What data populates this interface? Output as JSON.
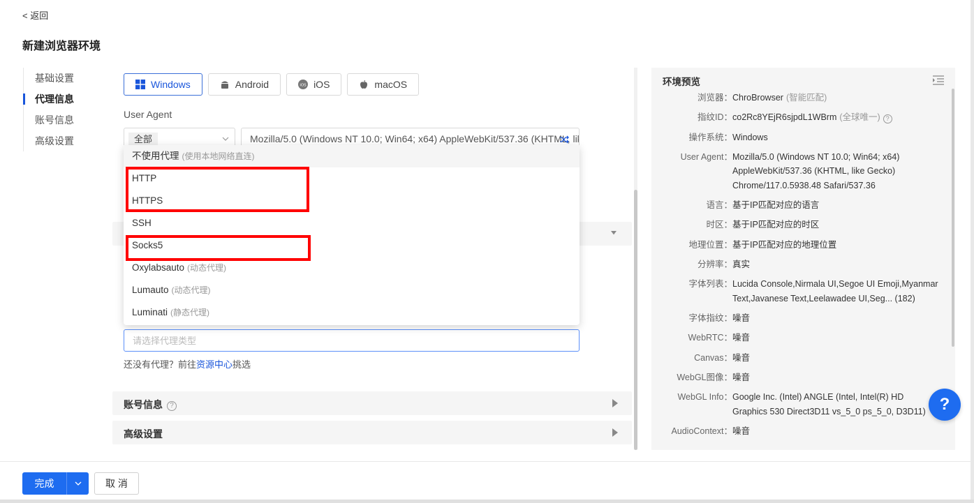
{
  "header": {
    "back": "< 返回",
    "title": "新建浏览器环境"
  },
  "nav": [
    {
      "label": "基础设置",
      "active": false
    },
    {
      "label": "代理信息",
      "active": true
    },
    {
      "label": "账号信息",
      "active": false
    },
    {
      "label": "高级设置",
      "active": false
    }
  ],
  "os_buttons": {
    "windows": "Windows",
    "android": "Android",
    "ios": "iOS",
    "macos": "macOS"
  },
  "user_agent": {
    "label": "User Agent",
    "filter": "全部",
    "value": "Mozilla/5.0 (Windows NT 10.0; Win64; x64) AppleWebKit/537.36 (KHTML, like Gecko) Chrome/117.0.5938.48 Safari/537.36"
  },
  "proxy_dropdown": {
    "options": [
      {
        "label": "不使用代理",
        "hint": "(使用本地网络直连)"
      },
      {
        "label": "HTTP",
        "hint": ""
      },
      {
        "label": "HTTPS",
        "hint": ""
      },
      {
        "label": "SSH",
        "hint": ""
      },
      {
        "label": "Socks5",
        "hint": ""
      },
      {
        "label": "Oxylabsauto",
        "hint": "(动态代理)"
      },
      {
        "label": "Lumauto",
        "hint": "(动态代理)"
      },
      {
        "label": "Luminati",
        "hint": "(静态代理)"
      }
    ]
  },
  "proxy_input": {
    "placeholder": "请选择代理类型"
  },
  "no_proxy": {
    "prefix": "还没有代理？前往",
    "link": "资源中心",
    "suffix": "挑选"
  },
  "sections": {
    "account": "账号信息",
    "advanced": "高级设置"
  },
  "preview": {
    "title": "环境预览",
    "browser": {
      "k": "浏览器：",
      "v": "ChroBrowser",
      "muted": "(智能匹配)"
    },
    "fingerprint": {
      "k": "指纹ID：",
      "v": "co2Rc8YEjR6sjpdL1WBrm",
      "muted": "(全球唯一)"
    },
    "os": {
      "k": "操作系统：",
      "v": "Windows"
    },
    "ua": {
      "k": "User Agent：",
      "v": "Mozilla/5.0 (Windows NT 10.0; Win64; x64) AppleWebKit/537.36 (KHTML, like Gecko) Chrome/117.0.5938.48 Safari/537.36"
    },
    "language": {
      "k": "语言：",
      "v": "基于IP匹配对应的语言"
    },
    "timezone": {
      "k": "时区：",
      "v": "基于IP匹配对应的时区"
    },
    "geo": {
      "k": "地理位置：",
      "v": "基于IP匹配对应的地理位置"
    },
    "resolution": {
      "k": "分辨率：",
      "v": "真实"
    },
    "fonts": {
      "k": "字体列表：",
      "v": "Lucida Console,Nirmala UI,Segoe UI Emoji,Myanmar Text,Javanese Text,Leelawadee UI,Seg... (182)"
    },
    "font_fp": {
      "k": "字体指纹：",
      "v": "噪音"
    },
    "webrtc": {
      "k": "WebRTC：",
      "v": "噪音"
    },
    "canvas": {
      "k": "Canvas：",
      "v": "噪音"
    },
    "webgl_img": {
      "k": "WebGL图像：",
      "v": "噪音"
    },
    "webgl_info": {
      "k": "WebGL Info：",
      "v": "Google Inc. (Intel) ANGLE (Intel, Intel(R) HD Graphics 530 Direct3D11 vs_5_0 ps_5_0, D3D11)"
    },
    "audio": {
      "k": "AudioContext：",
      "v": "噪音"
    }
  },
  "help": "?",
  "footer": {
    "done": "完成",
    "cancel": "取 消"
  },
  "colors": {
    "primary": "#1e6cf0",
    "highlight": "#ff0000"
  }
}
